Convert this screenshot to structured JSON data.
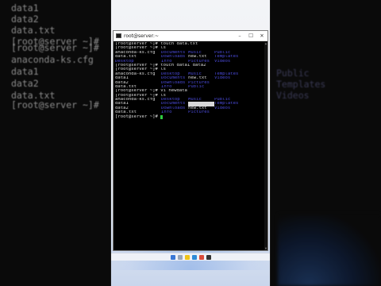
{
  "background_left": {
    "lines": [
      "data1",
      "data2",
      "data.txt",
      "[root@server ~]#",
      "[root@server ~]#",
      "anaconda-ks.cfg",
      "data1",
      "data2",
      "data.txt",
      "[root@server ~]#"
    ]
  },
  "background_right": {
    "lines": [
      "Public",
      "Templates",
      "Videos"
    ]
  },
  "window": {
    "title": "root@server:~",
    "controls": {
      "minimize": "–",
      "maximize": "☐",
      "close": "✕"
    }
  },
  "terminal": {
    "lines": [
      {
        "c1": "[root@server ~]# touch data.txt",
        "c2": "",
        "c3": "",
        "c4": ""
      },
      {
        "c1": "[root@server ~]# ls",
        "c2": "",
        "c3": "",
        "c4": ""
      },
      {
        "c1": "anaconda-ks.cfg",
        "c2": "Documents",
        "c3": "Music",
        "c4": "Public"
      },
      {
        "c1": "data.txt",
        "c2": "Downloads",
        "c3": "new.txt",
        "c4": "Templates"
      },
      {
        "c1": "Desktop",
        "c2": "Info",
        "c3": "Pictures",
        "c4": "Videos"
      },
      {
        "c1": "[root@server ~]# touch data1 data2",
        "c2": "",
        "c3": "",
        "c4": ""
      },
      {
        "c1": "[root@server ~]# ls",
        "c2": "",
        "c3": "",
        "c4": ""
      },
      {
        "c1": "anaconda-ks.cfg",
        "c2": "Desktop",
        "c3": "Music",
        "c4": "Templates"
      },
      {
        "c1": "data1",
        "c2": "Documents",
        "c3": "new.txt",
        "c4": "Videos"
      },
      {
        "c1": "data2",
        "c2": "Downloads",
        "c3": "Pictures",
        "c4": ""
      },
      {
        "c1": "data.txt",
        "c2": "Info",
        "c3": "Public",
        "c4": ""
      },
      {
        "c1": "[root@server ~]# vi newdata",
        "c2": "",
        "c3": "",
        "c4": ""
      },
      {
        "c1": "[root@server ~]# ls",
        "c2": "",
        "c3": "",
        "c4": ""
      },
      {
        "c1": "anaconda-ks.cfg",
        "c2": "Desktop",
        "c3": "Music",
        "c4": "Public"
      },
      {
        "c1": "data1",
        "c2": "Documents",
        "c3": "newdata",
        "c4": "Templates"
      },
      {
        "c1": "data2",
        "c2": "Downloads",
        "c3": "new.txt",
        "c4": "Videos"
      },
      {
        "c1": "data.txt",
        "c2": "Info",
        "c3": "Pictures",
        "c4": ""
      }
    ],
    "prompt": "[root@server ~]# ",
    "colors": {
      "text": "#d8d8d8",
      "dir": "#4a4ad8",
      "cursor": "#2ecc40"
    }
  }
}
